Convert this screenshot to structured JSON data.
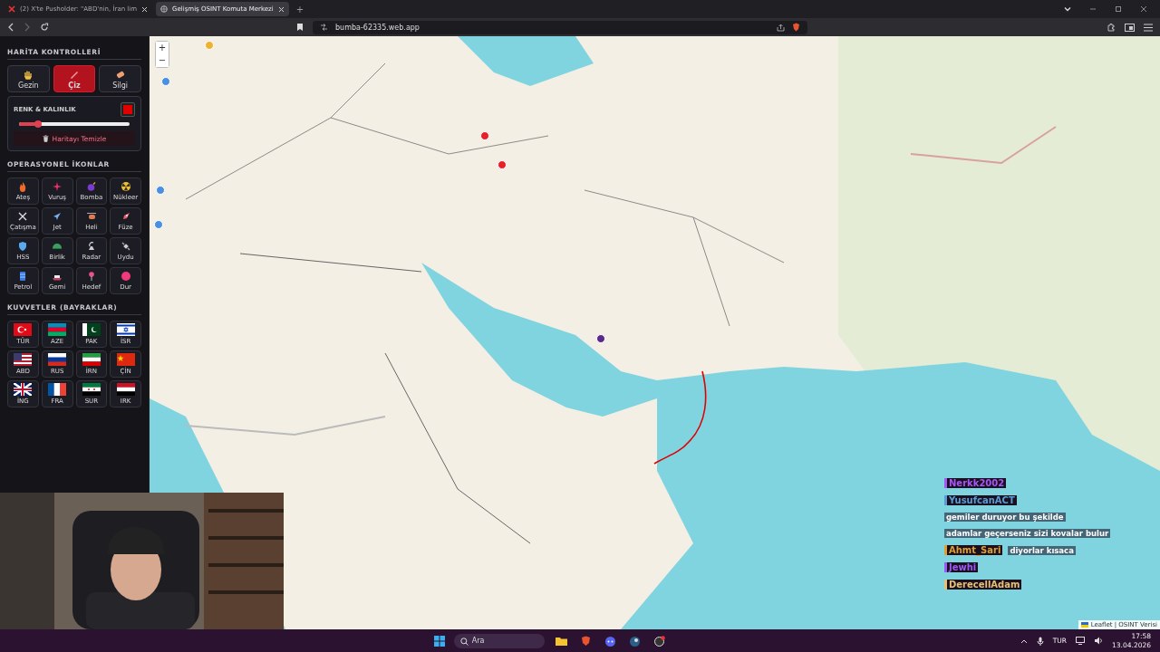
{
  "browser": {
    "tabs": [
      {
        "title": "(2) X'te Pusholder: \"ABD'nin, İran lim",
        "selected": false
      },
      {
        "title": "Gelişmiş OSINT Komuta Merkezi",
        "selected": true
      }
    ],
    "new_tab": "+",
    "url": "bumba-62335.web.app"
  },
  "sidebar": {
    "map_controls": {
      "heading": "HARİTA KONTROLLERİ",
      "tools": [
        {
          "label": "Gezin",
          "selected": false
        },
        {
          "label": "Çiz",
          "selected": true
        },
        {
          "label": "Silgi",
          "selected": false
        }
      ],
      "style_panel": {
        "label": "RENK & KALINLIK",
        "color": "#e00000",
        "level": 0.17,
        "clear_button": "Haritayı Temizle"
      }
    },
    "icons": {
      "heading": "OPERASYONEL İKONLAR",
      "items": [
        "Ateş",
        "Vuruş",
        "Bomba",
        "Nükleer",
        "Çatışma",
        "Jet",
        "Heli",
        "Füze",
        "HSS",
        "Birlik",
        "Radar",
        "Uydu",
        "Petrol",
        "Gemi",
        "Hedef",
        "Dur"
      ]
    },
    "forces": {
      "heading": "KUVVETLER (BAYRAKLAR)",
      "items": [
        "TÜR",
        "AZE",
        "PAK",
        "İSR",
        "ABD",
        "RUS",
        "İRN",
        "ÇİN",
        "İNG",
        "FRA",
        "SUR",
        "IRK"
      ]
    }
  },
  "map": {
    "zoom_in": "+",
    "zoom_out": "−",
    "markers": [
      {
        "color": "#f0b030"
      },
      {
        "color": "#4a90e2"
      },
      {
        "color": "#4a90e2"
      },
      {
        "color": "#4a90e2"
      },
      {
        "color": "#e8202a"
      },
      {
        "color": "#e8202a"
      },
      {
        "color": "#5a2a8a"
      }
    ],
    "attribution": "Leaflet | OSINT Verisi"
  },
  "chat": [
    {
      "user": "Nerkk2002",
      "color": "#a855f7"
    },
    {
      "user": "YusufcanACT",
      "color": "#5b9bd5"
    },
    {
      "message": "gemiler duruyor bu şekilde"
    },
    {
      "message": "adamlar geçerseniz sizi kovalar bulur"
    },
    {
      "user": "Ahmt_Sari",
      "color": "#e0a030",
      "message": "diyorlar kısaca"
    },
    {
      "user": "Jewhi",
      "color": "#9b59f6"
    },
    {
      "user": "DerecellAdam",
      "color": "#e8c070"
    }
  ],
  "taskbar": {
    "search_placeholder": "Ara",
    "language": "TUR",
    "time": "17:58",
    "date": "13.04.2026"
  }
}
